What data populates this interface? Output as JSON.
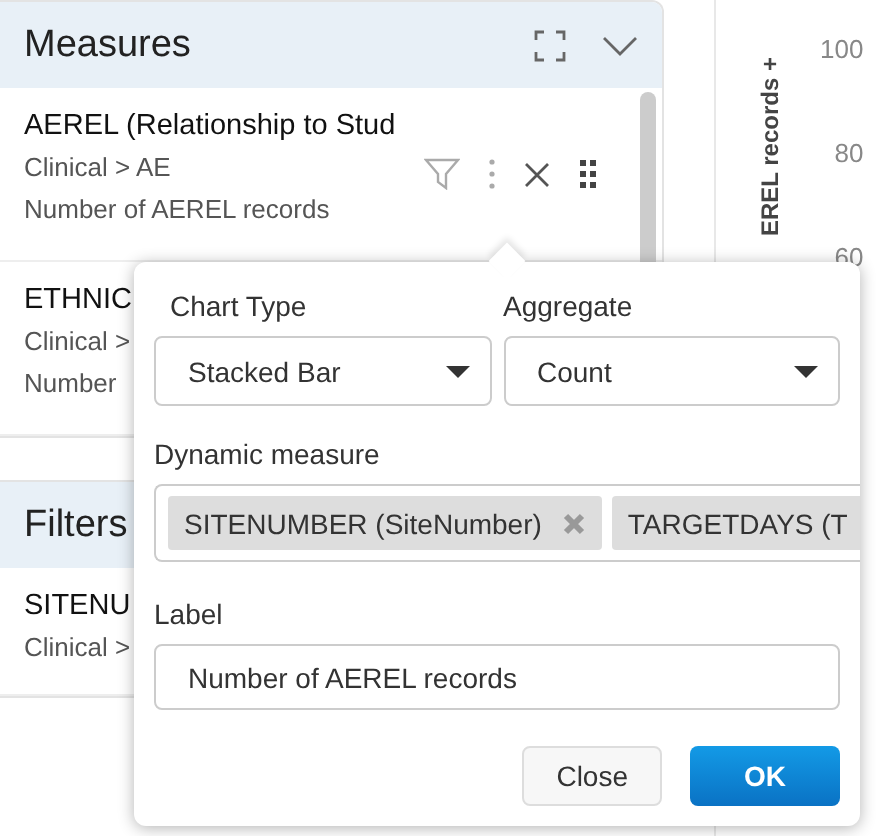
{
  "measures_panel": {
    "title": "Measures",
    "items": [
      {
        "name": "AEREL (Relationship to Stud",
        "path": "Clinical > AE",
        "description": "Number of AEREL records",
        "actions": true
      },
      {
        "name": "ETHNIC",
        "path": "Clinical >",
        "description": "Number",
        "actions": false
      }
    ]
  },
  "filters_panel": {
    "title": "Filters",
    "items": [
      {
        "name": "SITENU",
        "path": "Clinical >"
      }
    ]
  },
  "chart_axis": {
    "title": "EREL records +",
    "ticks": [
      "100",
      "80",
      "60"
    ]
  },
  "popup": {
    "chart_type": {
      "label": "Chart Type",
      "value": "Stacked Bar"
    },
    "aggregate": {
      "label": "Aggregate",
      "value": "Count"
    },
    "dynamic_measure": {
      "label": "Dynamic measure",
      "tags": [
        {
          "text": "SITENUMBER (SiteNumber)",
          "removable": true
        },
        {
          "text": "TARGETDAYS (T",
          "removable": false
        }
      ]
    },
    "label_field": {
      "label": "Label",
      "value": "Number of AEREL records"
    },
    "buttons": [
      {
        "text": "Close",
        "kind": "secondary"
      },
      {
        "text": "OK",
        "kind": "primary"
      }
    ]
  }
}
